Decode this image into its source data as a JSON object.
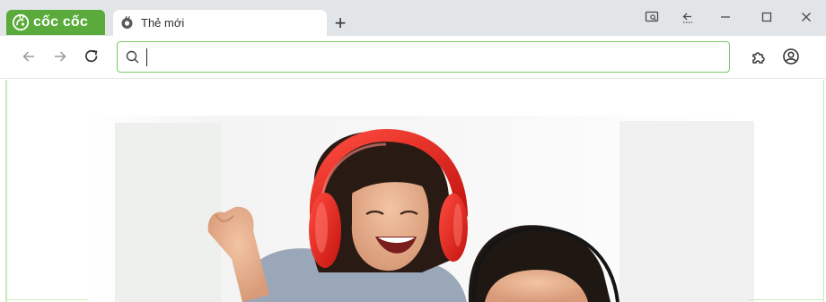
{
  "browser": {
    "brand_label": "cốc cốc",
    "tabs": [
      {
        "title": "Thẻ mới",
        "active": true
      }
    ],
    "new_tab_label": "+",
    "colors": {
      "brand_green": "#5aab3b",
      "omnibox_border": "#7ac96a",
      "headphones_red": "#e0261f"
    }
  },
  "toolbar": {
    "back_icon": "arrow-left-icon",
    "forward_icon": "arrow-right-icon",
    "reload_icon": "reload-icon",
    "search_value": "",
    "extensions_icon": "puzzle-icon",
    "profile_icon": "profile-icon"
  },
  "window_controls": {
    "icons": [
      "screenshot-icon",
      "sidebar-collapse-icon",
      "minimize-icon",
      "maximize-icon",
      "close-icon"
    ]
  },
  "content": {
    "hero_image": "photo of a smiling woman wearing red headphones next to a young man with headphones"
  }
}
